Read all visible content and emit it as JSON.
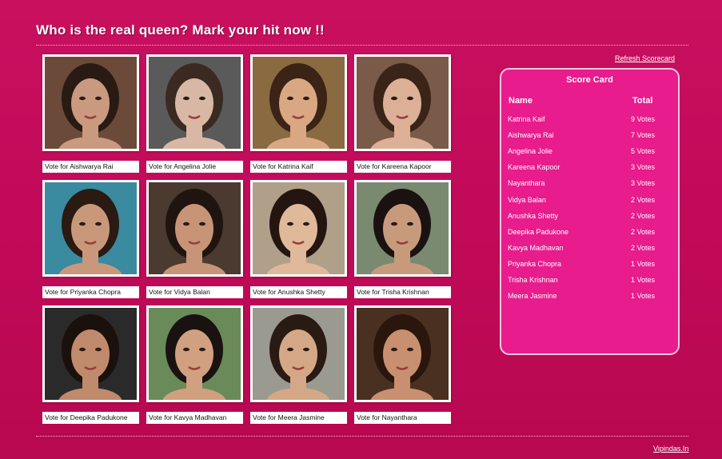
{
  "page": {
    "title": "Who is the real queen? Mark your hit now !!",
    "refresh_label": "Refresh Scorecard",
    "footer_link": "Vipindas.In"
  },
  "colors": {
    "background": "#c20a5a",
    "scorecard_bg": "#e81c8c",
    "scorecard_border": "#f7c9dd",
    "tile_bg": "#ffffff"
  },
  "tiles": [
    {
      "vote_label": "Vote for Aishwarya Rai",
      "photo_icon": "portrait-photo"
    },
    {
      "vote_label": "Vote for Angelina Jolie",
      "photo_icon": "portrait-photo"
    },
    {
      "vote_label": "Vote for Katrina Kaif",
      "photo_icon": "portrait-photo"
    },
    {
      "vote_label": "Vote for Kareena Kapoor",
      "photo_icon": "portrait-photo"
    },
    {
      "vote_label": "Vote for Priyanka Chopra",
      "photo_icon": "portrait-photo"
    },
    {
      "vote_label": "Vote for Vidya Balan",
      "photo_icon": "portrait-photo"
    },
    {
      "vote_label": "Vote for Anushka Shetty",
      "photo_icon": "portrait-photo"
    },
    {
      "vote_label": "Vote for Trisha Krishnan",
      "photo_icon": "portrait-photo"
    },
    {
      "vote_label": "Vote for Deepika Padukone",
      "photo_icon": "portrait-photo"
    },
    {
      "vote_label": "Vote for Kavya Madhavan",
      "photo_icon": "portrait-photo"
    },
    {
      "vote_label": "Vote for Meera Jasmine",
      "photo_icon": "portrait-photo"
    },
    {
      "vote_label": "Vote for Nayanthara",
      "photo_icon": "portrait-photo"
    }
  ],
  "scorecard": {
    "title": "Score Card",
    "header_name": "Name",
    "header_total": "Total",
    "rows": [
      {
        "name": "Katrina Kaif",
        "votes": "9 Votes"
      },
      {
        "name": "Aishwarya Rai",
        "votes": "7 Votes"
      },
      {
        "name": "Angelina Jolie",
        "votes": "5 Votes"
      },
      {
        "name": "Kareena Kapoor",
        "votes": "3 Votes"
      },
      {
        "name": "Nayanthara",
        "votes": "3 Votes"
      },
      {
        "name": "Vidya Balan",
        "votes": "2 Votes"
      },
      {
        "name": "Anushka Shetty",
        "votes": "2 Votes"
      },
      {
        "name": "Deepika Padukone",
        "votes": "2 Votes"
      },
      {
        "name": "Kavya Madhavan",
        "votes": "2 Votes"
      },
      {
        "name": "Priyanka Chopra",
        "votes": "1 Votes"
      },
      {
        "name": "Trisha Krishnan",
        "votes": "1 Votes"
      },
      {
        "name": "Meera Jasmine",
        "votes": "1 Votes"
      }
    ]
  }
}
